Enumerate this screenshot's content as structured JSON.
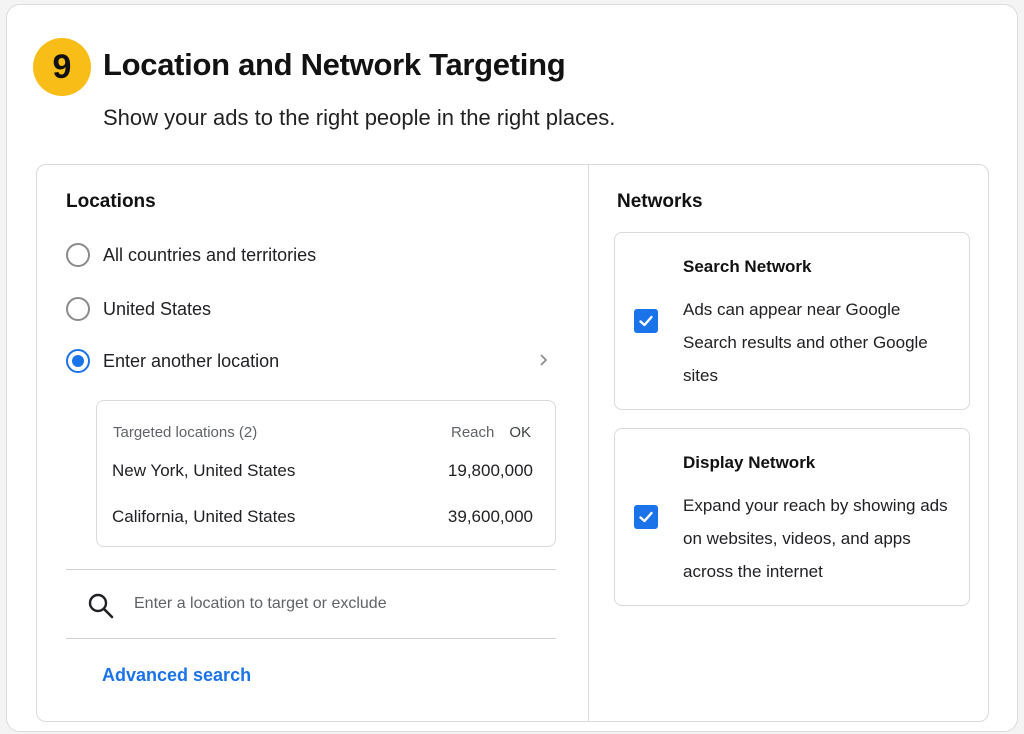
{
  "header": {
    "step_number": "9",
    "title": "Location and Network Targeting",
    "subtitle": "Show your ads to the right people in the right places."
  },
  "locations": {
    "title": "Locations",
    "options": [
      {
        "label": "All countries and territories",
        "selected": false
      },
      {
        "label": "United States",
        "selected": false
      },
      {
        "label": "Enter another location",
        "selected": true
      }
    ],
    "targeted": {
      "header_label": "Targeted locations (2)",
      "reach_label": "Reach",
      "ok_label": "OK",
      "rows": [
        {
          "name": "New York, United States",
          "reach": "19,800,000"
        },
        {
          "name": "California, United States",
          "reach": "39,600,000"
        }
      ]
    },
    "search_placeholder": "Enter a location to target or exclude",
    "advanced_search_label": "Advanced search"
  },
  "networks": {
    "title": "Networks",
    "items": [
      {
        "title": "Search Network",
        "description": "Ads can appear near Google Search results and other Google sites",
        "checked": true
      },
      {
        "title": "Display Network",
        "description": "Expand your reach by showing ads on websites, videos, and apps across the internet",
        "checked": true
      }
    ]
  },
  "colors": {
    "accent": "#1a73e8",
    "badge": "#f9bd17"
  }
}
